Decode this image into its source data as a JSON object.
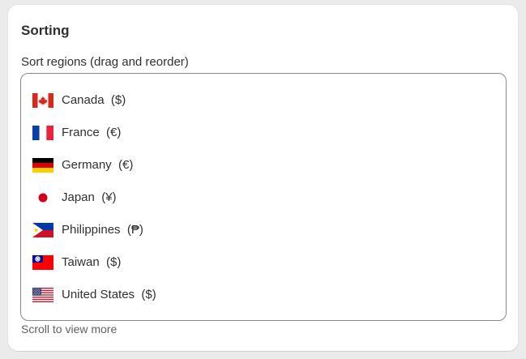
{
  "card": {
    "title": "Sorting",
    "field_label": "Sort regions (drag and reorder)",
    "help_text": "Scroll to view more"
  },
  "regions": [
    {
      "name": "Canada",
      "currency": "($)",
      "flag_icon": "canada-flag-icon"
    },
    {
      "name": "France",
      "currency": "(€)",
      "flag_icon": "france-flag-icon"
    },
    {
      "name": "Germany",
      "currency": "(€)",
      "flag_icon": "germany-flag-icon"
    },
    {
      "name": "Japan",
      "currency": "(¥)",
      "flag_icon": "japan-flag-icon"
    },
    {
      "name": "Philippines",
      "currency": "(₱)",
      "flag_icon": "philippines-flag-icon"
    },
    {
      "name": "Taiwan",
      "currency": "($)",
      "flag_icon": "taiwan-flag-icon"
    },
    {
      "name": "United States",
      "currency": "($)",
      "flag_icon": "united-states-flag-icon"
    }
  ],
  "colors": {
    "page_background": "#ebebeb",
    "card_background": "#ffffff",
    "text": "#303030",
    "muted_text": "#616161",
    "border": "#8a8a8a"
  }
}
